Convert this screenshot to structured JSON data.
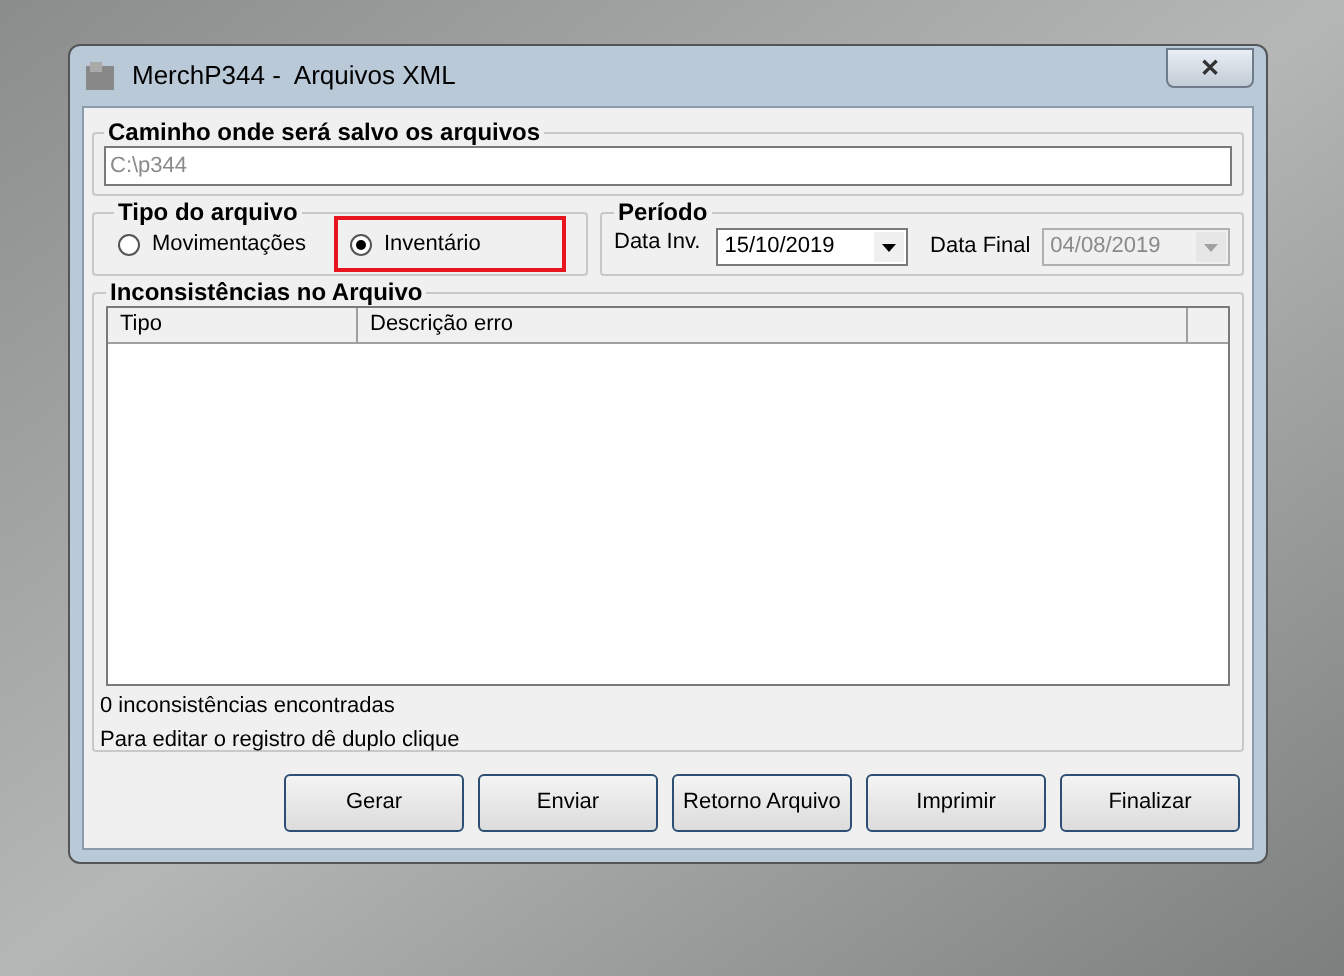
{
  "window": {
    "title": "MerchP344 -  Arquivos XML",
    "close": "✕"
  },
  "path_group": {
    "title": "Caminho onde será salvo os arquivos",
    "value": "C:\\p344"
  },
  "file_type": {
    "title": "Tipo do arquivo",
    "options": [
      {
        "label": "Movimentações",
        "selected": false,
        "highlighted": false
      },
      {
        "label": "Inventário",
        "selected": true,
        "highlighted": true
      }
    ]
  },
  "period": {
    "title": "Período",
    "fields": [
      {
        "label": "Data Inv.",
        "value": "15/10/2019",
        "disabled": false
      },
      {
        "label": "Data Final",
        "value": "04/08/2019",
        "disabled": true
      }
    ]
  },
  "inconsistencies": {
    "title": "Inconsistências no Arquivo",
    "table": {
      "columns": [
        "Tipo",
        "Descrição erro"
      ]
    },
    "status_lines": [
      "0 inconsistências encontradas",
      "Para editar o registro dê duplo clique"
    ]
  },
  "buttons": [
    "Gerar",
    "Enviar",
    "Retorno Arquivo",
    "Imprimir",
    "Finalizar"
  ]
}
